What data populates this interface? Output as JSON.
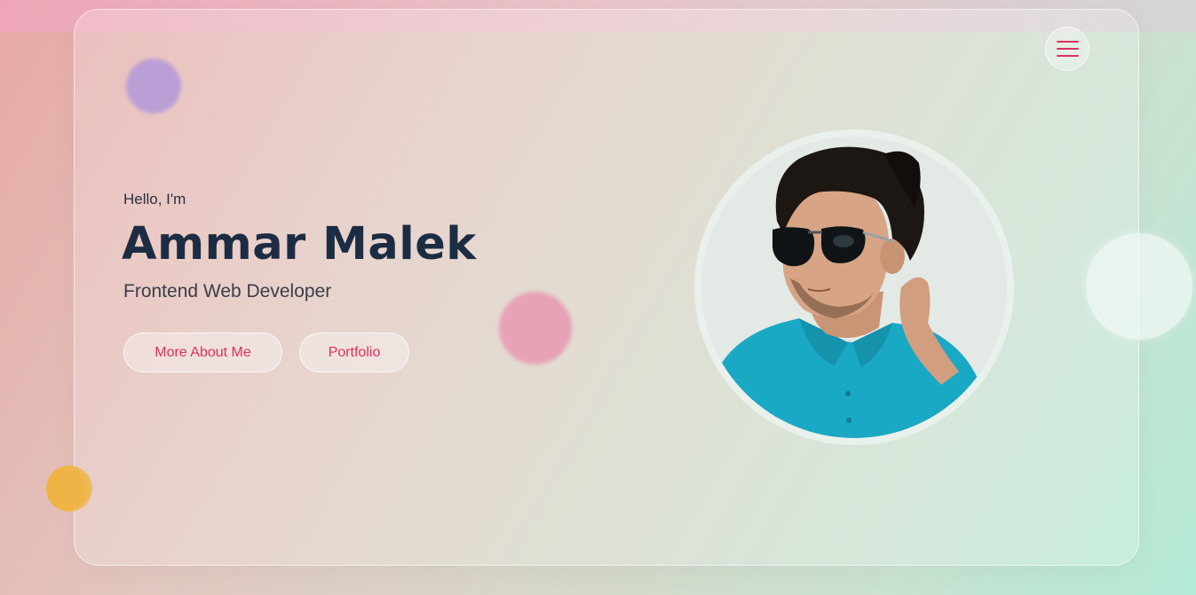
{
  "hero": {
    "greeting": "Hello, I'm",
    "name": "Ammar Malek",
    "role": "Frontend Web Developer"
  },
  "buttons": {
    "about_label": "More About Me",
    "portfolio_label": "Portfolio"
  },
  "nav": {
    "menu_icon": "hamburger-menu-icon"
  },
  "colors": {
    "accent": "#d9325f",
    "heading": "#1c2c43",
    "text": "#3a3d48"
  }
}
